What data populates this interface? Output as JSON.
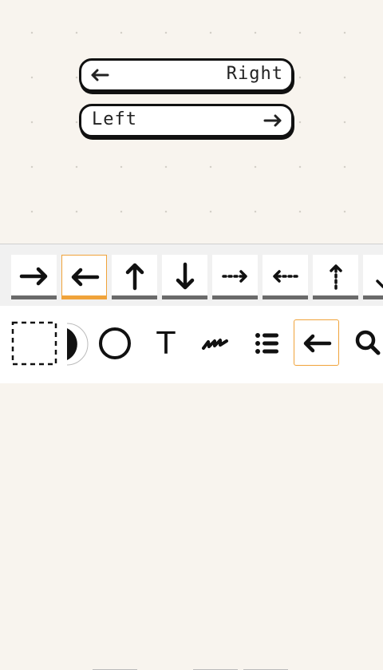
{
  "canvas": {
    "pills": [
      {
        "label": "Right",
        "arrow": "left-arrow-icon"
      },
      {
        "label": "Left",
        "arrow": "right-arrow-icon"
      }
    ]
  },
  "arrow_styles": [
    {
      "name": "arrow-right-solid",
      "selected": false
    },
    {
      "name": "arrow-left-solid",
      "selected": true
    },
    {
      "name": "arrow-up-solid",
      "selected": false
    },
    {
      "name": "arrow-down-solid",
      "selected": false
    },
    {
      "name": "arrow-right-dotted",
      "selected": false
    },
    {
      "name": "arrow-left-dotted",
      "selected": false
    },
    {
      "name": "arrow-up-dotted",
      "selected": false
    },
    {
      "name": "arrow-down-partial",
      "selected": false
    }
  ],
  "toolbar": {
    "text_tool_label": "T",
    "selected_tool": "arrow-tool",
    "accent": "#f0a33a"
  }
}
